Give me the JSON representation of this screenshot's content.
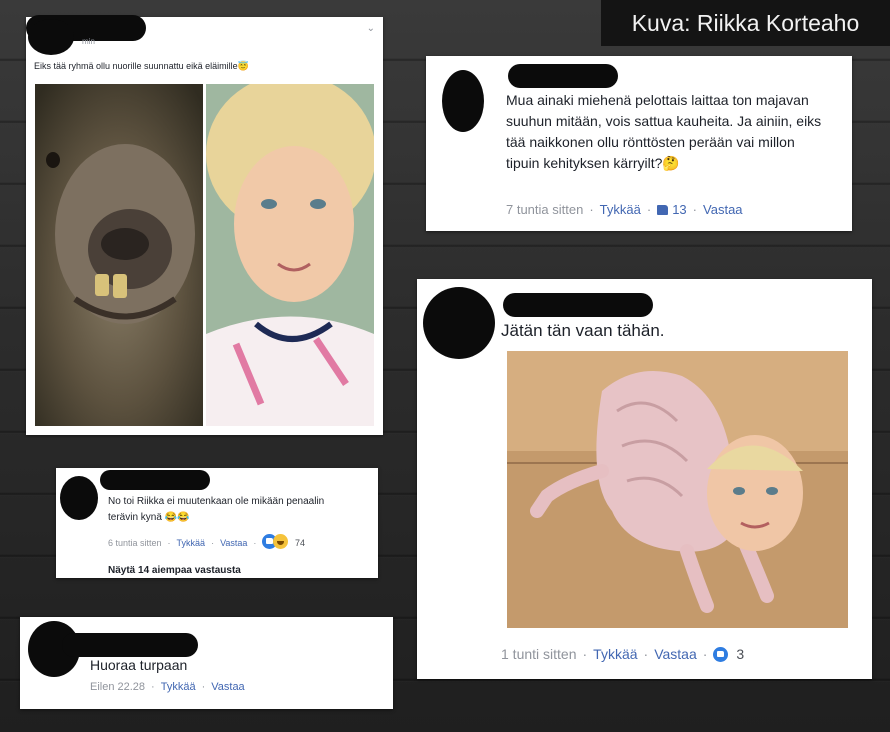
{
  "credit": "Kuva: Riikka Korteaho",
  "post1": {
    "subtitle": "min",
    "text": "Eiks tää ryhmä ollu nuorille suunnattu eikä eläimille😇"
  },
  "comment1": {
    "text": "Mua ainaki miehenä pelottais laittaa ton majavan suuhun mitään, vois sattua kauheita. Ja ainiin, eiks tää naikkonen ollu rönttösten perään vai millon tipuin kehityksen kärryilt?🤔",
    "time": "7 tuntia sitten",
    "like": "Tykkää",
    "likes_count": "13",
    "reply": "Vastaa"
  },
  "comment2": {
    "text": "Jätän tän vaan tähän.",
    "time": "1 tunti sitten",
    "like": "Tykkää",
    "reply": "Vastaa",
    "likes_count": "3"
  },
  "comment3": {
    "text": "No toi Riikka ei muutenkaan ole mikään penaalin terävin kynä 😂😂",
    "time": "6 tuntia sitten",
    "like": "Tykkää",
    "reply": "Vastaa",
    "reactions_count": "74",
    "more_replies": "Näytä 14 aiempaa vastausta"
  },
  "comment4": {
    "text": "Huoraa turpaan",
    "time": "Eilen 22.28",
    "like": "Tykkää",
    "reply": "Vastaa"
  }
}
